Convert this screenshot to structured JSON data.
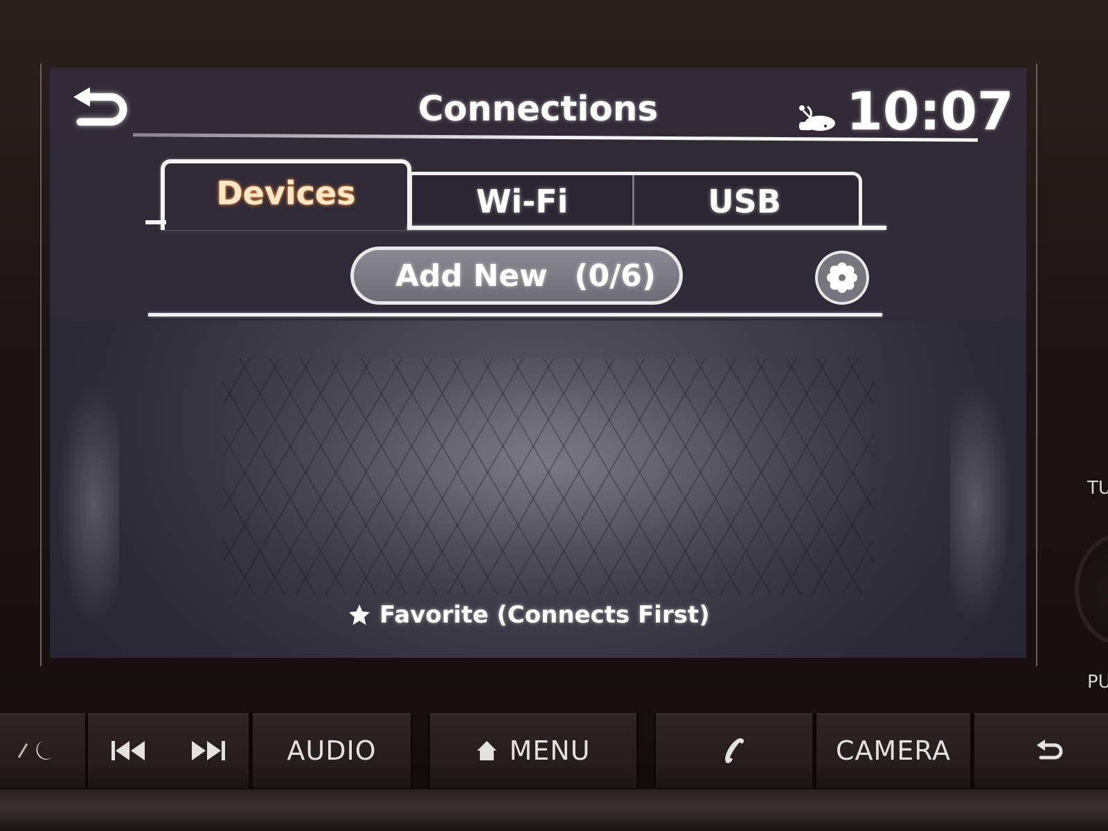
{
  "header": {
    "back_icon": "back-arrow-icon",
    "title": "Connections",
    "status_icon": "car-sound-status-icon",
    "clock": "10:07"
  },
  "tabs": [
    {
      "label": "Devices",
      "active": true
    },
    {
      "label": "Wi-Fi",
      "active": false
    },
    {
      "label": "USB",
      "active": false
    }
  ],
  "actions": {
    "add_new_label": "Add New",
    "device_count": "(0/6)",
    "settings_icon": "gear-icon"
  },
  "footer": {
    "favorite_icon": "star-icon",
    "favorite_label": "Favorite (Connects First)"
  },
  "colors": {
    "active_tab_text": "#ffe7c8",
    "active_tab_glow": "#ff9a40",
    "screen_bg": "#2e2a38",
    "line": "#f4f4f4"
  },
  "hardware_buttons": [
    {
      "id": "day-night",
      "label": "",
      "icon": "day-night-icon"
    },
    {
      "id": "seek",
      "label": "",
      "icon": "seek-prev-next-icon"
    },
    {
      "id": "audio",
      "label": "AUDIO",
      "icon": ""
    },
    {
      "id": "menu",
      "label": "MENU",
      "icon": "home-icon"
    },
    {
      "id": "phone",
      "label": "",
      "icon": "phone-icon"
    },
    {
      "id": "camera",
      "label": "CAMERA",
      "icon": ""
    },
    {
      "id": "back",
      "label": "",
      "icon": "back-arrow-icon"
    }
  ],
  "side_labels": {
    "knob_top": "TU",
    "knob_bottom": "PU"
  }
}
